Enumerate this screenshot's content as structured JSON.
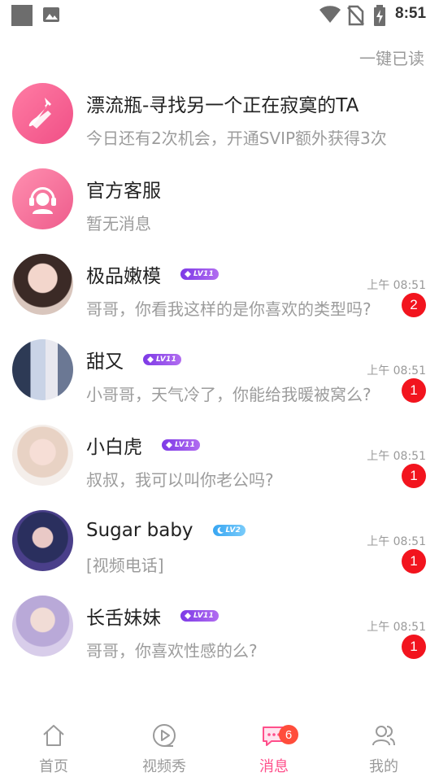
{
  "status_bar": {
    "time": "8:51"
  },
  "header": {
    "mark_all_read": "一键已读"
  },
  "conversations": [
    {
      "title": "漂流瓶-寻找另一个正在寂寞的TA",
      "subtitle": "今日还有2次机会，开通SVIP额外获得3次",
      "avatar_icon": "drift-bottle-icon"
    },
    {
      "title": "官方客服",
      "subtitle": "暂无消息",
      "avatar_icon": "customer-service-icon"
    },
    {
      "title": "极品嫩模",
      "level": "LV11",
      "level_color": "#8a44e8",
      "subtitle": "哥哥，你看我这样的是你喜欢的类型吗?",
      "time": "上午 08:51",
      "unread": "2"
    },
    {
      "title": "甜又",
      "level": "LV11",
      "level_color": "#8a44e8",
      "subtitle": "小哥哥，天气冷了，你能给我暖被窝么?",
      "time": "上午 08:51",
      "unread": "1"
    },
    {
      "title": "小白虎",
      "level": "LV11",
      "level_color": "#8a44e8",
      "subtitle": "叔叔，我可以叫你老公吗?",
      "time": "上午 08:51",
      "unread": "1"
    },
    {
      "title": "Sugar baby",
      "level": "LV2",
      "level_color": "#48b1f4",
      "subtitle": "[视频电话]",
      "time": "上午 08:51",
      "unread": "1"
    },
    {
      "title": "长舌妹妹",
      "level": "LV11",
      "level_color": "#8a44e8",
      "subtitle": "哥哥，你喜欢性感的么?",
      "time": "上午 08:51",
      "unread": "1"
    }
  ],
  "tabbar": {
    "tabs": [
      {
        "label": "首页",
        "icon": "home-icon"
      },
      {
        "label": "视频秀",
        "icon": "video-play-icon"
      },
      {
        "label": "消息",
        "icon": "message-icon",
        "badge": "6",
        "active": true
      },
      {
        "label": "我的",
        "icon": "profile-icon"
      }
    ]
  },
  "colors": {
    "accent": "#ff4f8b",
    "badge_red": "#f2141e"
  }
}
